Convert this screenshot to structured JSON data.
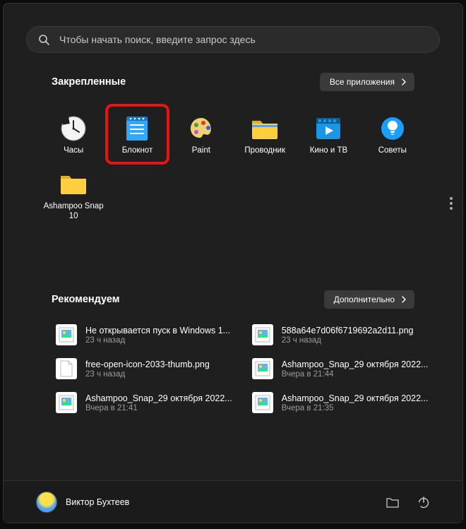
{
  "search": {
    "placeholder": "Чтобы начать поиск, введите запрос здесь"
  },
  "pinned": {
    "title": "Закрепленные",
    "all_button": "Все приложения",
    "items": [
      {
        "label": "Часы",
        "icon": "clock"
      },
      {
        "label": "Блокнот",
        "icon": "notepad",
        "highlight": true
      },
      {
        "label": "Paint",
        "icon": "paint"
      },
      {
        "label": "Проводник",
        "icon": "explorer"
      },
      {
        "label": "Кино и ТВ",
        "icon": "movies"
      },
      {
        "label": "Советы",
        "icon": "tips"
      },
      {
        "label": "Ashampoo Snap 10",
        "icon": "folder"
      }
    ]
  },
  "recommended": {
    "title": "Рекомендуем",
    "more_button": "Дополнительно",
    "items": [
      {
        "name": "Не открывается пуск в Windows 1...",
        "time": "23 ч назад",
        "thumb": "image"
      },
      {
        "name": "588a64e7d06f6719692a2d11.png",
        "time": "23 ч назад",
        "thumb": "image"
      },
      {
        "name": "free-open-icon-2033-thumb.png",
        "time": "23 ч назад",
        "thumb": "file"
      },
      {
        "name": "Ashampoo_Snap_29 октября 2022...",
        "time": "Вчера в 21:44",
        "thumb": "image"
      },
      {
        "name": "Ashampoo_Snap_29 октября 2022...",
        "time": "Вчера в 21:41",
        "thumb": "image"
      },
      {
        "name": "Ashampoo_Snap_29 октября 2022...",
        "time": "Вчера в 21:35",
        "thumb": "image"
      }
    ]
  },
  "footer": {
    "user_name": "Виктор Бухтеев"
  }
}
